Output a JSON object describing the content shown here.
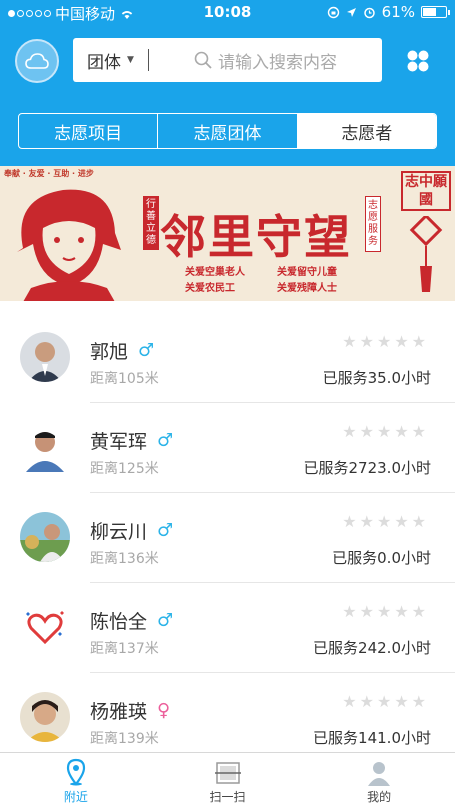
{
  "status_bar": {
    "carrier": "中国移动",
    "time": "10:08",
    "battery": "61%",
    "battery_level": 0.61
  },
  "search": {
    "type_select": "团体",
    "placeholder": "请输入搜索内容"
  },
  "tabs": [
    {
      "label": "志愿项目",
      "active": false
    },
    {
      "label": "志愿团体",
      "active": false
    },
    {
      "label": "志愿者",
      "active": true
    }
  ],
  "banner": {
    "slogan": "奉献 · 友爱 · 互助 · 进步",
    "title": "邻里守望",
    "side_left": "行善立德",
    "side_right": "志愿服务",
    "line1_a": "关爱空巢老人",
    "line1_b": "关爱留守儿童",
    "line2_a": "关爱农民工",
    "line2_b": "关爱残障人士",
    "stamp": "志中願國"
  },
  "volunteers": [
    {
      "name": "郭旭",
      "gender": "♂",
      "distance": "距离105米",
      "served": "已服务35.0小时",
      "rating": 0
    },
    {
      "name": "黄军珲",
      "gender": "♂",
      "distance": "距离125米",
      "served": "已服务2723.0小时",
      "rating": 0
    },
    {
      "name": "柳云川",
      "gender": "♂",
      "distance": "距离136米",
      "served": "已服务0.0小时",
      "rating": 0
    },
    {
      "name": "陈怡全",
      "gender": "♂",
      "distance": "距离137米",
      "served": "已服务242.0小时",
      "rating": 0
    },
    {
      "name": "杨雅瑛",
      "gender": "♀",
      "distance": "距离139米",
      "served": "已服务141.0小时",
      "rating": 0
    }
  ],
  "tabbar": [
    {
      "label": "附近",
      "icon": "location-pin-icon",
      "active": true
    },
    {
      "label": "扫一扫",
      "icon": "scan-icon",
      "active": false
    },
    {
      "label": "我的",
      "icon": "user-icon",
      "active": false
    }
  ],
  "colors": {
    "primary": "#1aa4ea",
    "banner_red": "#c8282d",
    "male": "#2bb3e8",
    "female": "#ec5f9b"
  }
}
